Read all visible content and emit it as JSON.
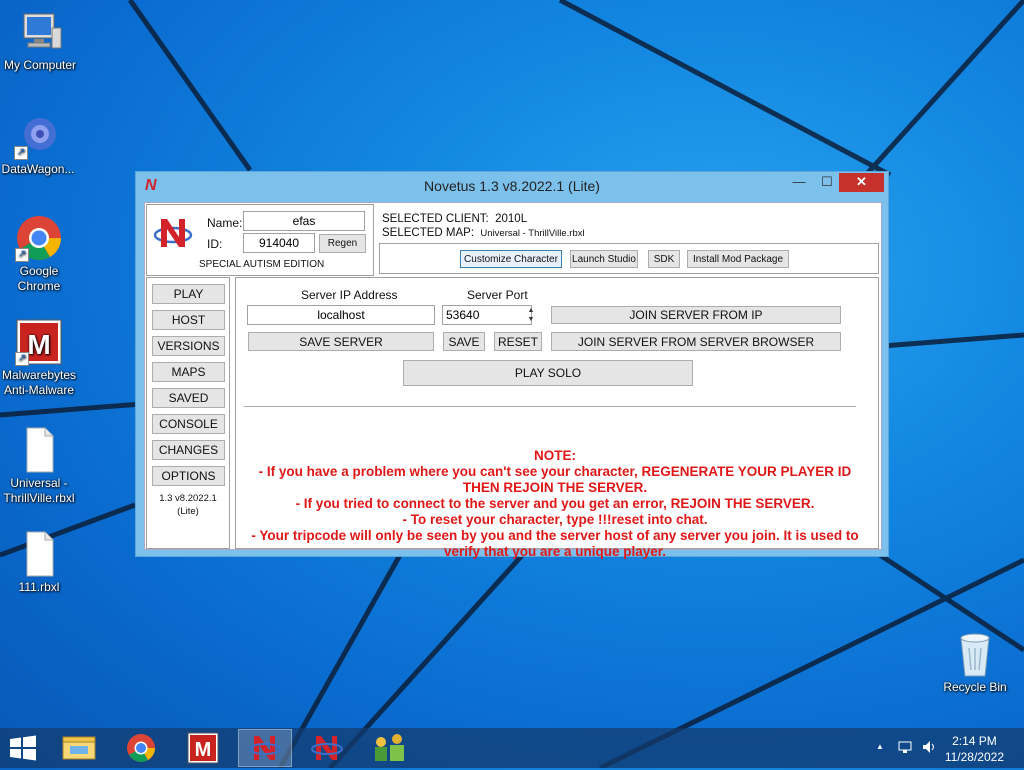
{
  "desktop": {
    "icons": [
      {
        "label": "My Computer"
      },
      {
        "label": "DataWagon..."
      },
      {
        "label": "Google Chrome"
      },
      {
        "label": "Malwarebytes Anti-Malware"
      },
      {
        "label": "Universal - ThrillVille.rbxl"
      },
      {
        "label": "111.rbxl"
      },
      {
        "label": "Recycle Bin"
      }
    ]
  },
  "window": {
    "title": "Novetus 1.3 v8.2022.1 (Lite)",
    "logo_letter": "N",
    "controls": {
      "minimize": "—",
      "maximize": "☐",
      "close": "✕"
    }
  },
  "profile": {
    "name_label": "Name:",
    "name_value": "efas",
    "id_label": "ID:",
    "id_value": "914040",
    "regen_label": "Regen",
    "edition": "SPECIAL AUTISM EDITION"
  },
  "selection": {
    "client_label": "SELECTED CLIENT:",
    "client_value": "2010L",
    "map_label": "SELECTED MAP:",
    "map_value": "Universal - ThrillVille.rbxl"
  },
  "tools": [
    {
      "label": "Customize Character"
    },
    {
      "label": "Launch Studio"
    },
    {
      "label": "SDK"
    },
    {
      "label": "Install Mod Package"
    }
  ],
  "nav": {
    "items": [
      {
        "label": "PLAY"
      },
      {
        "label": "HOST"
      },
      {
        "label": "VERSIONS"
      },
      {
        "label": "MAPS"
      },
      {
        "label": "SAVED"
      },
      {
        "label": "CONSOLE"
      },
      {
        "label": "CHANGES"
      },
      {
        "label": "OPTIONS"
      }
    ],
    "version": "1.3 v8.2022.1 (Lite)"
  },
  "play": {
    "ip_label": "Server IP Address",
    "ip_value": "localhost",
    "port_label": "Server Port",
    "port_value": "53640",
    "join_ip": "JOIN SERVER FROM IP",
    "save_server": "SAVE SERVER",
    "save": "SAVE",
    "reset": "RESET",
    "join_browser": "JOIN SERVER FROM SERVER BROWSER",
    "play_solo": "PLAY SOLO"
  },
  "note": {
    "lines": [
      "NOTE:",
      "- If you have a problem where you can't see your character, REGENERATE YOUR PLAYER ID THEN REJOIN THE SERVER.",
      "- If you tried to connect to the server and you get an error, REJOIN THE SERVER.",
      "- To reset your character, type !!!reset into chat.",
      "- Your tripcode will only be seen by you and the server host of any server you join. It is used to verify that you are a unique player."
    ]
  },
  "taskbar": {
    "time": "2:14 PM",
    "date": "11/28/2022",
    "tray_up": "▲"
  },
  "colors": {
    "note_red": "#e01818",
    "close_red": "#c7312b",
    "logo_red": "#d2232a"
  }
}
